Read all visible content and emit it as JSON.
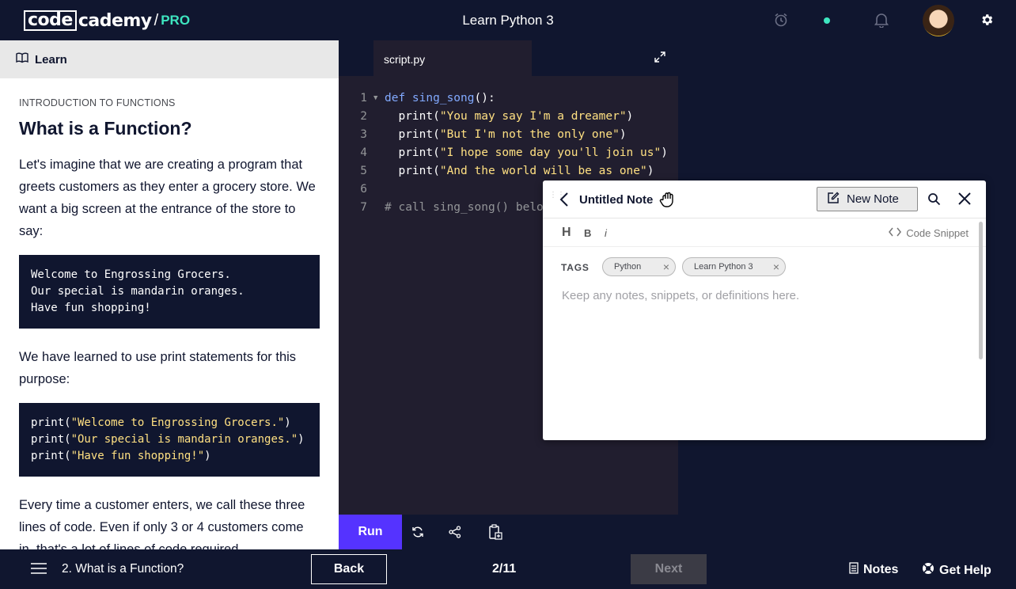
{
  "header": {
    "logo_code": "code",
    "logo_cademy": "cademy",
    "logo_slash": "/",
    "logo_pro": "PRO",
    "title": "Learn Python 3",
    "icons": [
      "alarm-clock-icon",
      "status-dot",
      "bell-icon",
      "avatar",
      "gear-icon"
    ]
  },
  "learn": {
    "tab_label": "Learn",
    "kicker": "INTRODUCTION TO FUNCTIONS",
    "title": "What is a Function?",
    "para1": "Let's imagine that we are creating a program that greets customers as they enter a grocery store. We want a big screen at the entrance of the store to say:",
    "code1": [
      "Welcome to Engrossing Grocers.",
      "Our special is mandarin oranges.",
      "Have fun shopping!"
    ],
    "para2": "We have learned to use print statements for this purpose:",
    "code2": [
      {
        "pre": "print(",
        "str": "\"Welcome to Engrossing Grocers.\"",
        "post": ")"
      },
      {
        "pre": "print(",
        "str": "\"Our special is mandarin oranges.\"",
        "post": ")"
      },
      {
        "pre": "print(",
        "str": "\"Have fun shopping!\"",
        "post": ")"
      }
    ],
    "para3": "Every time a customer enters, we call these three lines of code. Even if only 3 or 4 customers come in, that's a lot of lines of code required."
  },
  "editor": {
    "filename": "script.py",
    "lines": [
      {
        "n": "1",
        "kw": "def ",
        "fn": "sing_song",
        "rest": "():",
        "str": "",
        "end": "",
        "comment": ""
      },
      {
        "n": "2",
        "kw": "",
        "fn": "",
        "rest": "  print(",
        "str": "\"You may say I'm a dreamer\"",
        "end": ")",
        "comment": ""
      },
      {
        "n": "3",
        "kw": "",
        "fn": "",
        "rest": "  print(",
        "str": "\"But I'm not the only one\"",
        "end": ")",
        "comment": ""
      },
      {
        "n": "4",
        "kw": "",
        "fn": "",
        "rest": "  print(",
        "str": "\"I hope some day you'll join us\"",
        "end": ")",
        "comment": ""
      },
      {
        "n": "5",
        "kw": "",
        "fn": "",
        "rest": "  print(",
        "str": "\"And the world will be as one\"",
        "end": ")",
        "comment": ""
      },
      {
        "n": "6",
        "kw": "",
        "fn": "",
        "rest": "",
        "str": "",
        "end": "",
        "comment": ""
      },
      {
        "n": "7",
        "kw": "",
        "fn": "",
        "rest": "",
        "str": "",
        "end": "",
        "comment": "# call sing_song() below"
      }
    ],
    "run_label": "Run"
  },
  "notes": {
    "title": "Untitled Note",
    "new_note_label": "New Note",
    "format": {
      "heading": "H",
      "bold": "B",
      "italic": "i"
    },
    "snippet_label": "Code Snippet",
    "tags_label": "TAGS",
    "tags": [
      "Python",
      "Learn Python 3"
    ],
    "tag_remove": "×",
    "placeholder": "Keep any notes, snippets, or definitions here."
  },
  "footer": {
    "lesson": "2. What is a Function?",
    "back_label": "Back",
    "progress": "2/11",
    "next_label": "Next",
    "notes_label": "Notes",
    "help_label": "Get Help"
  },
  "colors": {
    "navy": "#10162f",
    "editor_bg": "#211e2f",
    "run_purple": "#5533ff",
    "pro_teal": "#3ee6c0",
    "code_string": "#ffe082",
    "code_keyword": "#82aaff"
  }
}
